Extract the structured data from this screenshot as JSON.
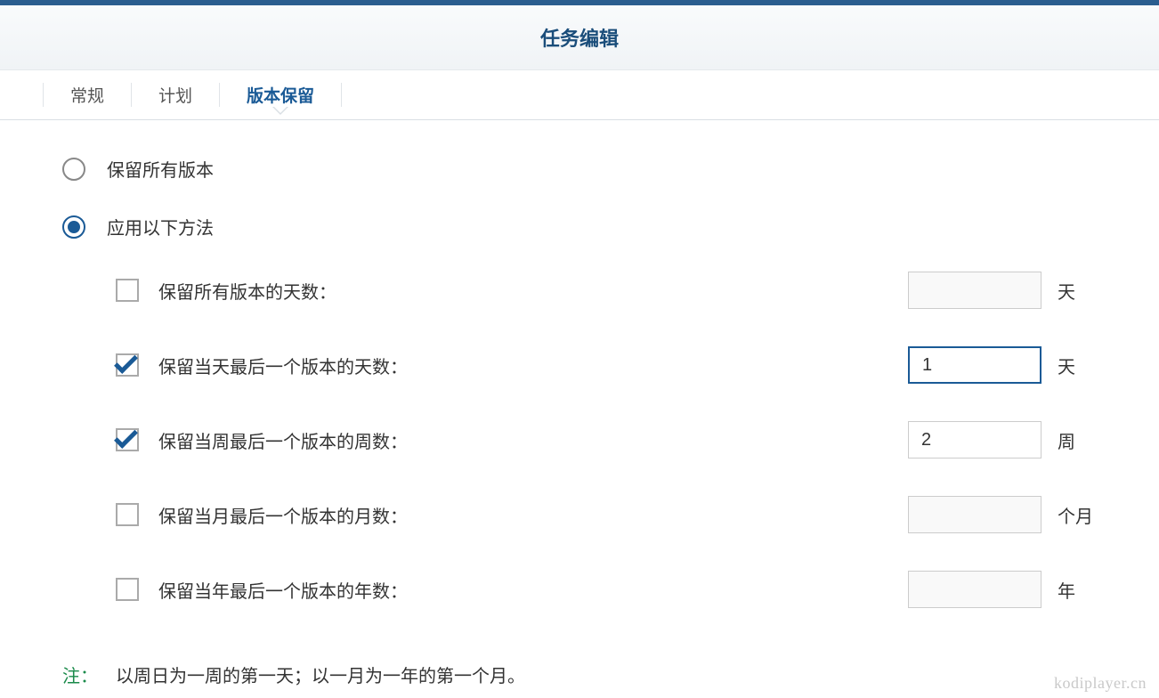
{
  "header": {
    "title": "任务编辑"
  },
  "tabs": [
    {
      "label": "常规",
      "active": false
    },
    {
      "label": "计划",
      "active": false
    },
    {
      "label": "版本保留",
      "active": true
    }
  ],
  "radios": {
    "keep_all": {
      "label": "保留所有版本",
      "selected": false
    },
    "apply_method": {
      "label": "应用以下方法",
      "selected": true
    }
  },
  "options": [
    {
      "key": "all_days",
      "label": "保留所有版本的天数：",
      "checked": false,
      "value": "",
      "unit": "天",
      "focused": false
    },
    {
      "key": "last_day",
      "label": "保留当天最后一个版本的天数：",
      "checked": true,
      "value": "1",
      "unit": "天",
      "focused": true
    },
    {
      "key": "last_week",
      "label": "保留当周最后一个版本的周数：",
      "checked": true,
      "value": "2",
      "unit": "周",
      "focused": false
    },
    {
      "key": "last_month",
      "label": "保留当月最后一个版本的月数：",
      "checked": false,
      "value": "",
      "unit": "个月",
      "focused": false
    },
    {
      "key": "last_year",
      "label": "保留当年最后一个版本的年数：",
      "checked": false,
      "value": "",
      "unit": "年",
      "focused": false
    }
  ],
  "note": {
    "label": "注：",
    "text": "以周日为一周的第一天；以一月为一年的第一个月。"
  },
  "watermark": "kodiplayer.cn"
}
